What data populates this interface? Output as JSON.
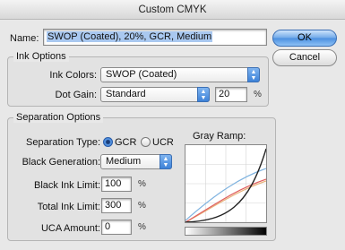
{
  "window": {
    "title": "Custom CMYK"
  },
  "name": {
    "label": "Name:",
    "value": "SWOP (Coated), 20%, GCR, Medium"
  },
  "buttons": {
    "ok": "OK",
    "cancel": "Cancel"
  },
  "ink_options": {
    "title": "Ink Options",
    "ink_colors_label": "Ink Colors:",
    "ink_colors_value": "SWOP (Coated)",
    "dot_gain_label": "Dot Gain:",
    "dot_gain_value": "Standard",
    "dot_gain_amount": "20",
    "dot_gain_unit": "%"
  },
  "separation_options": {
    "title": "Separation Options",
    "type_label": "Separation Type:",
    "gcr_label": "GCR",
    "ucr_label": "UCR",
    "selected_type": "GCR",
    "black_generation_label": "Black Generation:",
    "black_generation_value": "Medium",
    "black_ink_limit_label": "Black Ink Limit:",
    "black_ink_limit_value": "100",
    "total_ink_limit_label": "Total Ink Limit:",
    "total_ink_limit_value": "300",
    "uca_amount_label": "UCA Amount:",
    "uca_amount_value": "0",
    "percent": "%",
    "gray_ramp_label": "Gray Ramp:"
  },
  "colors": {
    "cyan_curve": "#7fb3e0",
    "magenta_curve": "#e06060",
    "yellow_curve": "#e8b27a",
    "black_curve": "#222222"
  }
}
